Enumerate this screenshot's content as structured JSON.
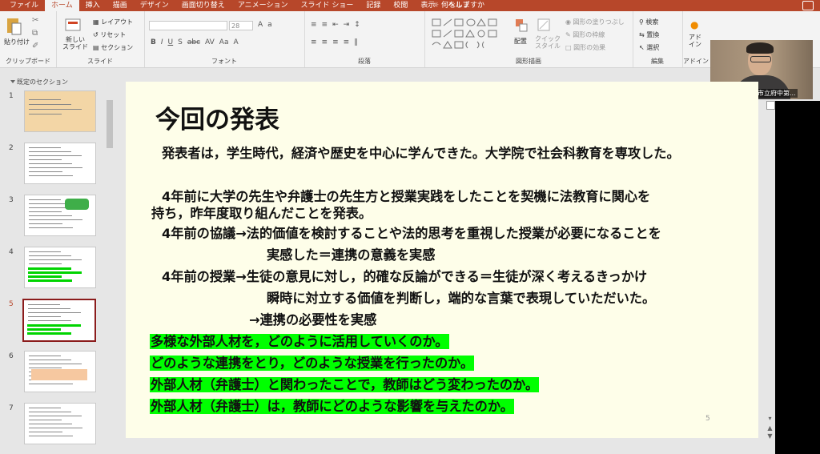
{
  "ribbon_tabs": [
    "ファイル",
    "ホーム",
    "挿入",
    "描画",
    "デザイン",
    "画面切り替え",
    "アニメーション",
    "スライド ショー",
    "記録",
    "校閲",
    "表示",
    "ヘルプ"
  ],
  "active_tab_index": 1,
  "tell_me": "何をしますか",
  "ribbon": {
    "paste": "貼り付け",
    "clipboard": "クリップボード",
    "new_slide": "新しい\nスライド",
    "layout": "レイアウト",
    "reset": "リセット",
    "section": "セクション",
    "slides_group": "スライド",
    "font_group": "フォント",
    "paragraph_group": "段落",
    "arrange": "配置",
    "quick_style": "クイック\nスタイル",
    "shape_fill": "図形の塗りつぶし",
    "shape_outline": "図形の枠線",
    "shape_effects": "図形の効果",
    "drawing_group": "図形描画",
    "find": "検索",
    "replace": "置換",
    "select": "選択",
    "editing_group": "編集",
    "addin": "アド\nイン",
    "addin_group": "アドイン",
    "font_size": "28"
  },
  "webcam": {
    "name": "岩渕公輔（府中市立府中第..."
  },
  "left_pane": {
    "section_label": "既定のセクション",
    "slide_numbers": [
      "1",
      "2",
      "3",
      "4",
      "5",
      "6",
      "7"
    ],
    "selected_index": 4
  },
  "slide": {
    "title": "今回の発表",
    "lines": [
      "発表者は，学生時代，経済や歴史を中心に学んできた。大学院で社会科教育を専攻した。",
      "4年前に大学の先生や弁護士の先生方と授業実践をしたことを契機に法教育に関心を",
      "持ち，昨年度取り組んだことを発表。",
      "4年前の協議→法的価値を検討することや法的思考を重視した授業が必要になることを",
      "実感した＝連携の意義を実感",
      "4年前の授業→生徒の意見に対し，的確な反論ができる＝生徒が深く考えるきっかけ",
      "瞬時に対立する価値を判断し，端的な言葉で表現していただいた。",
      "→連携の必要性を実感"
    ],
    "highlighted": [
      "多様な外部人材を，どのように活用していくのか。",
      "どのような連携をとり，どのような授業を行ったのか。",
      "外部人材（弁護士）と関わったことで，教師はどう変わったのか。",
      "外部人材（弁護士）は，教師にどのような影響を与えたのか。"
    ],
    "page_number": "5",
    "highlight_color": "#00ff00"
  },
  "colors": {
    "accent": "#b7472a",
    "slide_bg": "#fefee9"
  }
}
